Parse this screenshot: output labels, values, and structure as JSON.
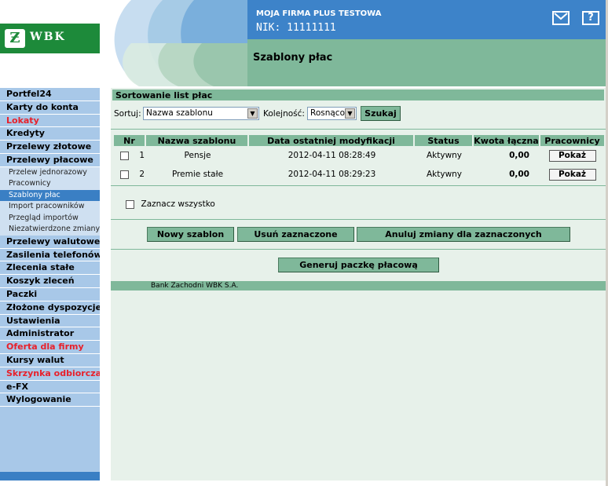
{
  "header": {
    "logo_text": "WBK",
    "company_name": "MOJA FIRMA PLUS TESTOWA",
    "nik": "NIK: 11111111",
    "page_title": "Szablony płac",
    "help_glyph": "?"
  },
  "colors": {
    "brand_green": "#1d8a3a",
    "header_blue": "#3d83c9",
    "accent_green": "#7fb89a",
    "sidebar_blue": "#a8c8e8",
    "active_blue": "#3a7fc4",
    "alert_red": "#e8202a"
  },
  "sidebar": {
    "items": [
      {
        "label": "Portfel24",
        "style": "normal"
      },
      {
        "label": "Karty do konta",
        "style": "normal"
      },
      {
        "label": "Lokaty",
        "style": "red"
      },
      {
        "label": "Kredyty",
        "style": "normal"
      },
      {
        "label": "Przelewy złotowe",
        "style": "normal"
      },
      {
        "label": "Przelewy płacowe",
        "style": "normal"
      }
    ],
    "subitems": [
      {
        "label": "Przelew jednorazowy"
      },
      {
        "label": "Pracownicy"
      },
      {
        "label": "Szablony płac",
        "active": true
      },
      {
        "label": "Import pracowników"
      },
      {
        "label": "Przegląd importów"
      },
      {
        "label": "Niezatwierdzone zmiany"
      }
    ],
    "items_after": [
      {
        "label": "Przelewy walutowe",
        "style": "normal"
      },
      {
        "label": "Zasilenia telefonów",
        "style": "normal"
      },
      {
        "label": "Zlecenia stałe",
        "style": "normal"
      },
      {
        "label": "Koszyk zleceń",
        "style": "normal"
      },
      {
        "label": "Paczki",
        "style": "normal"
      },
      {
        "label": "Złożone dyspozycje",
        "style": "normal"
      },
      {
        "label": "Ustawienia",
        "style": "normal"
      },
      {
        "label": "Administrator",
        "style": "normal"
      },
      {
        "label": "Oferta dla firmy",
        "style": "red"
      },
      {
        "label": "Kursy walut",
        "style": "normal"
      },
      {
        "label": "Skrzynka odbiorcza",
        "style": "red"
      },
      {
        "label": "e-FX",
        "style": "normal"
      },
      {
        "label": "Wylogowanie",
        "style": "normal"
      }
    ]
  },
  "main": {
    "section_title": "Sortowanie list płac",
    "sort_label": "Sortuj:",
    "sort_value": "Nazwa szablonu",
    "order_label": "Kolejność:",
    "order_value": "Rosnąco",
    "search_button": "Szukaj",
    "table": {
      "columns": [
        "Nr",
        "Nazwa szablonu",
        "Data ostatniej modyfikacji",
        "Status",
        "Kwota łączna",
        "Pracownicy"
      ],
      "rows": [
        {
          "nr": "1",
          "name": "Pensje",
          "modified": "2012-04-11 08:28:49",
          "status": "Aktywny",
          "amount": "0,00",
          "action": "Pokaż"
        },
        {
          "nr": "2",
          "name": "Premie stałe",
          "modified": "2012-04-11 08:29:23",
          "status": "Aktywny",
          "amount": "0,00",
          "action": "Pokaż"
        }
      ]
    },
    "select_all_label": "Zaznacz wszystko",
    "buttons": {
      "new_template": "Nowy szablon",
      "delete_selected": "Usuń zaznaczone",
      "cancel_changes": "Anuluj zmiany dla zaznaczonych",
      "generate_package": "Generuj paczkę płacową"
    },
    "footer_text": "Bank Zachodni WBK S.A."
  }
}
